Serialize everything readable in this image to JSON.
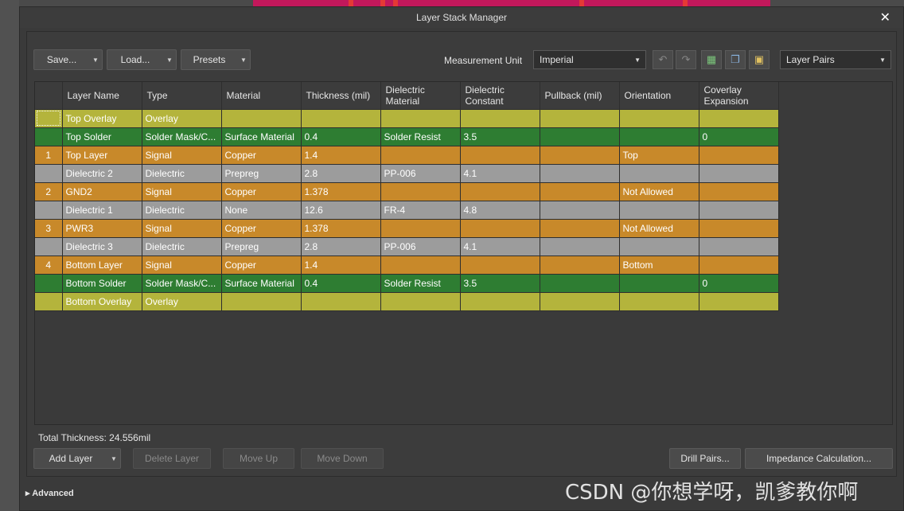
{
  "window": {
    "title": "Layer Stack Manager"
  },
  "toolbar": {
    "save_label": "Save...",
    "load_label": "Load...",
    "presets_label": "Presets",
    "measurement_unit_label": "Measurement Unit",
    "measurement_unit_value": "Imperial",
    "layer_pairs_value": "Layer Pairs"
  },
  "table": {
    "headers": [
      "",
      "Layer Name",
      "Type",
      "Material",
      "Thickness (mil)",
      "Dielectric Material",
      "Dielectric Constant",
      "Pullback (mil)",
      "Orientation",
      "Coverlay Expansion"
    ],
    "rows": [
      {
        "kind": "overlay",
        "cells": [
          "",
          "Top Overlay",
          "Overlay",
          "",
          "",
          "",
          "",
          "",
          "",
          ""
        ]
      },
      {
        "kind": "solder",
        "cells": [
          "",
          "Top Solder",
          "Solder Mask/C...",
          "Surface Material",
          "0.4",
          "Solder Resist",
          "3.5",
          "",
          "",
          "0"
        ]
      },
      {
        "kind": "signal",
        "cells": [
          "1",
          "Top Layer",
          "Signal",
          "Copper",
          "1.4",
          "",
          "",
          "",
          "Top",
          ""
        ]
      },
      {
        "kind": "dielectric",
        "cells": [
          "",
          "Dielectric 2",
          "Dielectric",
          "Prepreg",
          "2.8",
          "PP-006",
          "4.1",
          "",
          "",
          ""
        ]
      },
      {
        "kind": "signal",
        "cells": [
          "2",
          "GND2",
          "Signal",
          "Copper",
          "1.378",
          "",
          "",
          "",
          "Not Allowed",
          ""
        ]
      },
      {
        "kind": "dielectric",
        "cells": [
          "",
          "Dielectric 1",
          "Dielectric",
          "None",
          "12.6",
          "FR-4",
          "4.8",
          "",
          "",
          ""
        ]
      },
      {
        "kind": "signal",
        "cells": [
          "3",
          "PWR3",
          "Signal",
          "Copper",
          "1.378",
          "",
          "",
          "",
          "Not Allowed",
          ""
        ]
      },
      {
        "kind": "dielectric",
        "cells": [
          "",
          "Dielectric 3",
          "Dielectric",
          "Prepreg",
          "2.8",
          "PP-006",
          "4.1",
          "",
          "",
          ""
        ]
      },
      {
        "kind": "signal",
        "cells": [
          "4",
          "Bottom Layer",
          "Signal",
          "Copper",
          "1.4",
          "",
          "",
          "",
          "Bottom",
          ""
        ]
      },
      {
        "kind": "solder",
        "cells": [
          "",
          "Bottom Solder",
          "Solder Mask/C...",
          "Surface Material",
          "0.4",
          "Solder Resist",
          "3.5",
          "",
          "",
          "0"
        ]
      },
      {
        "kind": "overlay",
        "cells": [
          "",
          "Bottom Overlay",
          "Overlay",
          "",
          "",
          "",
          "",
          "",
          "",
          ""
        ]
      }
    ]
  },
  "footer": {
    "total_thickness": "Total Thickness: 24.556mil",
    "add_layer_label": "Add Layer",
    "delete_layer_label": "Delete Layer",
    "move_up_label": "Move Up",
    "move_down_label": "Move Down",
    "drill_pairs_label": "Drill Pairs...",
    "impedance_label": "Impedance Calculation...",
    "advanced_label": "Advanced"
  },
  "watermark": "CSDN @你想学呀，凯爹教你啊",
  "colors": {
    "overlay_row": "#b4b43c",
    "solder_row": "#2e7d32",
    "signal_row": "#c8892a",
    "dielectric_row": "#9c9c9c"
  },
  "icons": [
    "undo-icon",
    "redo-icon",
    "add-layer-pair-icon",
    "copy-icon",
    "paste-icon",
    "close-icon",
    "expand-arrow-icon"
  ]
}
